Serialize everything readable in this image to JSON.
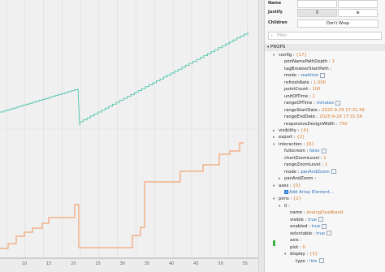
{
  "chart": {
    "x_ticks": [
      "10",
      "15",
      "20",
      "25",
      "30",
      "35",
      "40",
      "45",
      "50",
      "55"
    ],
    "series": [
      {
        "color": "#5cc8b2",
        "kind": "stair-rise-drop"
      },
      {
        "color": "#f4a474",
        "kind": "stair-steps"
      }
    ]
  },
  "panel": {
    "name_label": "Name",
    "justify_label": "Justify",
    "children_label": "Children",
    "children_value": "Don't Wrap",
    "search_placeholder": "Filter",
    "props_label": "PROPS"
  },
  "tree": [
    {
      "key": "config",
      "value": "{17}",
      "vclass": "v",
      "indent": 0,
      "arrow": "▾"
    },
    {
      "key": "penNamePathDepth",
      "value": "1",
      "vclass": "v",
      "indent": 1
    },
    {
      "key": "tagBrowserStartPath",
      "value": "",
      "vclass": "v",
      "indent": 1
    },
    {
      "key": "mode",
      "value": "realtime",
      "vclass": "v blue",
      "indent": 1
    },
    {
      "key": "refreshRate",
      "value": "1,000",
      "vclass": "v",
      "indent": 1
    },
    {
      "key": "pointCount",
      "value": "100",
      "vclass": "v",
      "indent": 1
    },
    {
      "key": "unitOfTime",
      "value": "1",
      "vclass": "v",
      "indent": 1
    },
    {
      "key": "rangeOfTime",
      "value": "minutes",
      "vclass": "v blue",
      "indent": 1
    },
    {
      "key": "rangeStartDate",
      "value": "2025-9-29 17:31:56",
      "vclass": "v",
      "indent": 1
    },
    {
      "key": "rangeEndDate",
      "value": "2025-9-29 17:31:56",
      "vclass": "v",
      "indent": 1
    },
    {
      "key": "responsiveDesignWidth",
      "value": "750",
      "vclass": "v",
      "indent": 1
    },
    {
      "key": "visibility",
      "value": "{4}",
      "vclass": "v",
      "indent": 0,
      "arrow": "▸"
    },
    {
      "key": "export",
      "value": "{2}",
      "vclass": "v",
      "indent": 0,
      "arrow": "▸"
    },
    {
      "key": "interaction",
      "value": "{6}",
      "vclass": "v",
      "indent": 0,
      "arrow": "▾"
    },
    {
      "key": "fullscreen",
      "value": "false",
      "vclass": "v blue",
      "indent": 1
    },
    {
      "key": "chartZoomLevel",
      "value": "1",
      "vclass": "v",
      "indent": 1
    },
    {
      "key": "rangeZoomLevel",
      "value": "1",
      "vclass": "v",
      "indent": 1
    },
    {
      "key": "mode",
      "value": "panAndZoom",
      "vclass": "v blue",
      "indent": 1
    },
    {
      "key": "panAndZoom",
      "value": "",
      "vclass": "v",
      "indent": 1,
      "arrow": "▸"
    },
    {
      "key": "axes",
      "value": "{0}",
      "vclass": "v",
      "indent": 0,
      "arrow": "▾"
    },
    {
      "key": "",
      "value": "Add Array Element...",
      "vclass": "linkblue",
      "indent": 1
    },
    {
      "key": "pens",
      "value": "{2}",
      "vclass": "v",
      "indent": 0,
      "arrow": "▾"
    },
    {
      "key": "0",
      "value": "",
      "vclass": "v",
      "indent": 1,
      "arrow": "▾"
    },
    {
      "key": "name",
      "value": "analogDeadband",
      "vclass": "v",
      "indent": 2
    },
    {
      "key": "visible",
      "value": "true",
      "vclass": "v blue",
      "indent": 2
    },
    {
      "key": "enabled",
      "value": "true",
      "vclass": "v blue",
      "indent": 2
    },
    {
      "key": "selectable",
      "value": "true",
      "vclass": "v blue",
      "indent": 2
    },
    {
      "key": "axis",
      "value": "",
      "vclass": "v",
      "indent": 2
    },
    {
      "key": "plot",
      "value": "0",
      "vclass": "v",
      "indent": 2
    },
    {
      "key": "display",
      "value": "{3}",
      "vclass": "v",
      "indent": 2,
      "arrow": "▾"
    },
    {
      "key": "type",
      "value": "line",
      "vclass": "v blue",
      "indent": 3
    }
  ]
}
